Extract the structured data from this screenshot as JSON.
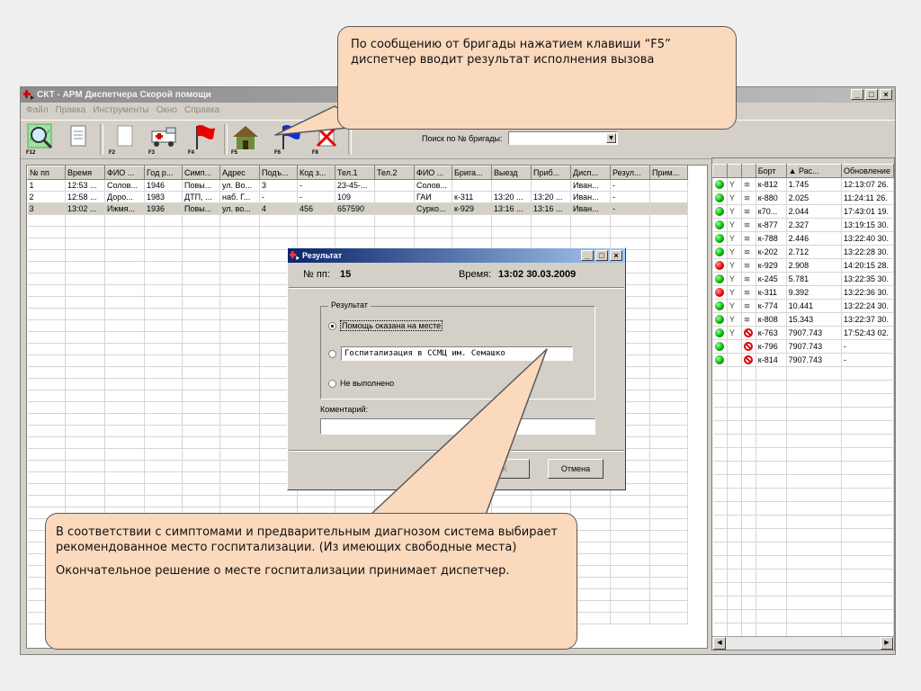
{
  "window": {
    "title": "СКТ - АРМ Диспетчера Скорой помощи",
    "controls": [
      "_",
      "□",
      "×"
    ]
  },
  "menu": [
    "Файл",
    "Правка",
    "Инструменты",
    "Окно",
    "Справка"
  ],
  "toolbar": {
    "buttons": [
      {
        "icon": "magnifier-map-icon",
        "key": "F12"
      },
      {
        "icon": "document-icon",
        "key": ""
      },
      {
        "icon": "blank-page-icon",
        "key": "F2"
      },
      {
        "icon": "ambulance-icon",
        "key": "F3"
      },
      {
        "icon": "red-flag-icon",
        "key": "F4"
      },
      {
        "icon": "house-icon",
        "key": "F5"
      },
      {
        "icon": "blue-flag-icon",
        "key": "F6"
      },
      {
        "icon": "cancel-document-icon",
        "key": "F8"
      }
    ],
    "search_label": "Поиск по № бригады:",
    "search_value": ""
  },
  "calls": {
    "columns": [
      "№ пп",
      "Время",
      "ФИО ...",
      "Год р...",
      "Симп...",
      "Адрес",
      "Подъ...",
      "Код з...",
      "Тел.1",
      "Тел.2",
      "ФИО ...",
      "Брига...",
      "Выезд",
      "Приб...",
      "Дисп...",
      "Резул...",
      "Прим..."
    ],
    "rows": [
      [
        "1",
        "12:53 ...",
        "Солов...",
        "1946",
        "Повы...",
        "ул. Во...",
        "3",
        "-",
        "23-45-...",
        "",
        "Солов...",
        "",
        "",
        "",
        "Иван...",
        "-",
        ""
      ],
      [
        "2",
        "12:58 ...",
        "Доро...",
        "1983",
        "ДТП, ...",
        "наб. Г...",
        "-",
        "-",
        "109",
        "",
        "ГАИ",
        "к-311",
        "13:20 ...",
        "13:20 ...",
        "Иван...",
        "-",
        ""
      ],
      [
        "3",
        "13:02 ...",
        "Ижмя...",
        "1936",
        "Повы...",
        "ул. во...",
        "4",
        "456",
        "657590",
        "",
        "Сурко...",
        "к-929",
        "13:16 ...",
        "13:16 ...",
        "Иван...",
        "-",
        ""
      ]
    ],
    "selected_row": 2
  },
  "brigades": {
    "columns": [
      "",
      "",
      "",
      "Борт",
      "▲   Рас...",
      "Обновление"
    ],
    "rows": [
      {
        "status": "green",
        "link": "antenna",
        "bort": "к-812",
        "dist": "1.745",
        "updated": "12:13:07 26."
      },
      {
        "status": "green",
        "link": "antenna",
        "bort": "к-880",
        "dist": "2.025",
        "updated": "11:24:11 26."
      },
      {
        "status": "green",
        "link": "antenna",
        "bort": "к70...",
        "dist": "2.044",
        "updated": "17:43:01 19."
      },
      {
        "status": "green",
        "link": "antenna",
        "bort": "к-877",
        "dist": "2.327",
        "updated": "13:19:15 30."
      },
      {
        "status": "green",
        "link": "antenna",
        "bort": "к-788",
        "dist": "2.446",
        "updated": "13:22:40 30."
      },
      {
        "status": "green",
        "link": "antenna",
        "bort": "к-202",
        "dist": "2.712",
        "updated": "13:22:28 30."
      },
      {
        "status": "red",
        "link": "antenna",
        "bort": "к-929",
        "dist": "2.908",
        "updated": "14:20:15 28."
      },
      {
        "status": "green",
        "link": "antenna",
        "bort": "к-245",
        "dist": "5.781",
        "updated": "13:22:35 30."
      },
      {
        "status": "red",
        "link": "antenna",
        "bort": "к-311",
        "dist": "9.392",
        "updated": "13:22:36 30."
      },
      {
        "status": "green",
        "link": "antenna",
        "bort": "к-774",
        "dist": "10.441",
        "updated": "13:22:24 30."
      },
      {
        "status": "green",
        "link": "antenna",
        "bort": "к-808",
        "dist": "15.343",
        "updated": "13:22:37 30."
      },
      {
        "status": "green",
        "link": "antenna-off",
        "bort": "к-763",
        "dist": "7907.743",
        "updated": "17:52:43 02."
      },
      {
        "status": "green",
        "link": "off",
        "bort": "к-796",
        "dist": "7907.743",
        "updated": "-"
      },
      {
        "status": "green",
        "link": "off",
        "bort": "к-814",
        "dist": "7907.743",
        "updated": "-"
      }
    ]
  },
  "dialog": {
    "title": "Результат",
    "num_label": "№ пп:",
    "num_value": "15",
    "time_label": "Время:",
    "time_value": "13:02 30.03.2009",
    "group_label": "Результат",
    "options": [
      "Помощь оказана на месте",
      "",
      "Не выполнено"
    ],
    "hospital": "Госпитализация в ССМЦ им. Семашко",
    "comment_label": "Коментарий:",
    "comment_value": "",
    "ok": "ОК",
    "cancel": "Отмена"
  },
  "callouts": {
    "top": "По сообщению от бригады нажатием клавиши “F5”  диспетчер вводит результат исполнения вызова",
    "bottom_p1": "В соответствии с симптомами и предварительным диагнозом система выбирает рекомендованное место госпитализации. (Из имеющих свободные места)",
    "bottom_p2": "Окончательное решение о месте госпитализации принимает диспетчер."
  },
  "colors": {
    "callout_fill": "#fbd9bd",
    "dialog_title": "#0a246a",
    "window_face": "#d4d0c8"
  }
}
